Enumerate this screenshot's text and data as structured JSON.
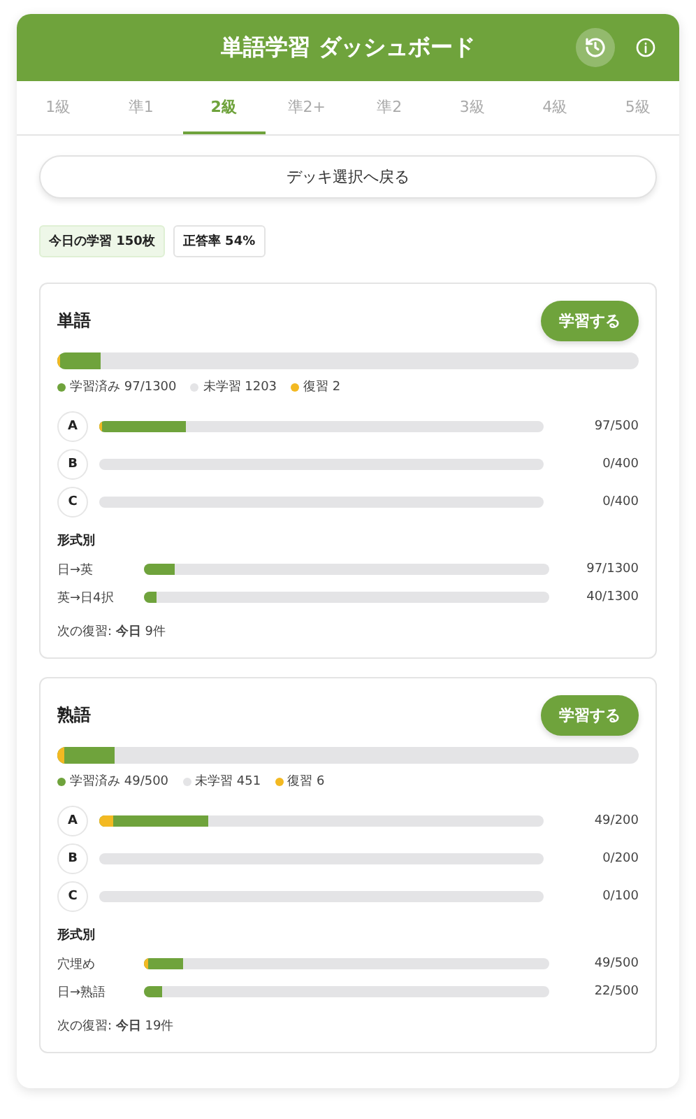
{
  "header": {
    "title": "単語学習 ダッシュボード"
  },
  "tabs": [
    {
      "label": "1級",
      "selected": false
    },
    {
      "label": "準1",
      "selected": false
    },
    {
      "label": "2級",
      "selected": true
    },
    {
      "label": "準2+",
      "selected": false
    },
    {
      "label": "準2",
      "selected": false
    },
    {
      "label": "3級",
      "selected": false
    },
    {
      "label": "4級",
      "selected": false
    },
    {
      "label": "5級",
      "selected": false
    }
  ],
  "back_button": "デッキ選択へ戻る",
  "chips": [
    {
      "kind": "accent",
      "label": "今日の学習 150枚"
    },
    {
      "kind": "plain",
      "label": "正答率 54%"
    }
  ],
  "cards": [
    {
      "title": "単語",
      "study_button": "学習する",
      "bar": [
        {
          "kind": "learned",
          "level": 0.075
        },
        {
          "kind": "review",
          "level": 0.005
        }
      ],
      "legend": [
        {
          "label": "学習済み 97/1300",
          "color": "#6fa33c"
        },
        {
          "label": "未学習 1203",
          "color": "#e4e4e6"
        },
        {
          "label": "復習 2",
          "color": "#f3b922"
        }
      ],
      "levels": [
        {
          "label": "A",
          "count": "97/500",
          "bar": [
            {
              "kind": "learned",
              "level": 0.196
            },
            {
              "kind": "review",
              "level": 0.006
            }
          ]
        },
        {
          "label": "B",
          "count": "0/400"
        },
        {
          "label": "C",
          "count": "0/400"
        }
      ],
      "format_title": "形式別",
      "formats": [
        {
          "label": "日→英",
          "count": "97/1300",
          "bar": [
            {
              "kind": "learned",
              "level": 0.075
            }
          ]
        },
        {
          "label": "英→日4択",
          "count": "40/1300",
          "bar": [
            {
              "kind": "learned",
              "level": 0.031
            }
          ]
        }
      ],
      "next_review": "次の復習: **今日** 9件"
    },
    {
      "title": "熟語",
      "study_button": "学習する",
      "bar": [
        {
          "kind": "learned",
          "level": 0.098
        },
        {
          "kind": "review",
          "level": 0.012
        }
      ],
      "legend": [
        {
          "label": "学習済み 49/500",
          "color": "#6fa33c"
        },
        {
          "label": "未学習 451",
          "color": "#e4e4e6"
        },
        {
          "label": "復習 6",
          "color": "#f3b922"
        }
      ],
      "levels": [
        {
          "label": "A",
          "count": "49/200",
          "bar": [
            {
              "kind": "learned",
              "level": 0.245
            },
            {
              "kind": "review",
              "level": 0.03
            }
          ]
        },
        {
          "label": "B",
          "count": "0/200"
        },
        {
          "label": "C",
          "count": "0/100"
        }
      ],
      "format_title": "形式別",
      "formats": [
        {
          "label": "穴埋め",
          "count": "49/500",
          "bar": [
            {
              "kind": "learned",
              "level": 0.095
            },
            {
              "kind": "review",
              "level": 0.01
            }
          ]
        },
        {
          "label": "日→熟語",
          "count": "22/500",
          "bar": [
            {
              "kind": "learned",
              "level": 0.044
            }
          ]
        }
      ],
      "next_review": "次の復習: **今日** 19件"
    }
  ]
}
